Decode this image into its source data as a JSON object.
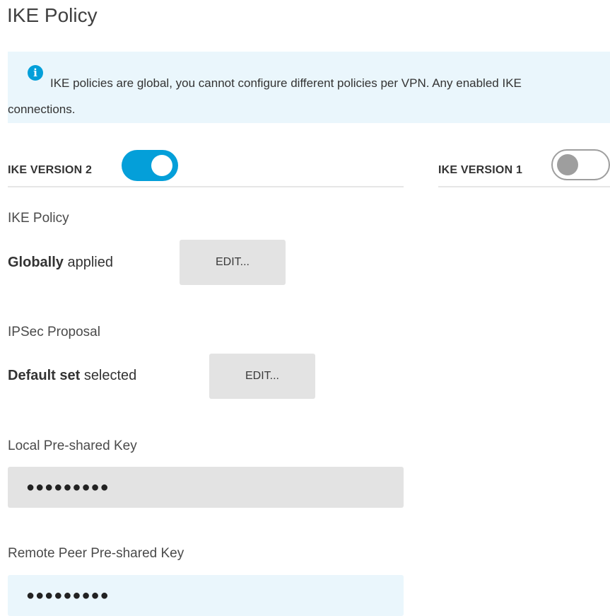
{
  "page": {
    "title": "IKE Policy"
  },
  "info_banner": {
    "icon": "info-icon",
    "line1": "IKE policies are global, you cannot configure different policies per VPN. Any enabled IKE",
    "line2": "connections."
  },
  "ike_versions": {
    "v2": {
      "label": "IKE VERSION 2",
      "enabled": true
    },
    "v1": {
      "label": "IKE VERSION 1",
      "enabled": false
    }
  },
  "ike_policy": {
    "label": "IKE Policy",
    "status_bold": "Globally",
    "status_rest": "applied",
    "edit_label": "EDIT..."
  },
  "ipsec_proposal": {
    "label": "IPSec Proposal",
    "status_bold": "Default set",
    "status_rest": "selected",
    "edit_label": "EDIT..."
  },
  "local_key": {
    "label": "Local Pre-shared Key",
    "value": "●●●●●●●●●"
  },
  "remote_key": {
    "label": "Remote Peer Pre-shared Key",
    "value": "●●●●●●●●●"
  },
  "colors": {
    "accent": "#049fd9",
    "banner_bg": "#eaf6fc",
    "button_bg": "#e3e3e3",
    "toggle_off": "#9e9e9e"
  }
}
